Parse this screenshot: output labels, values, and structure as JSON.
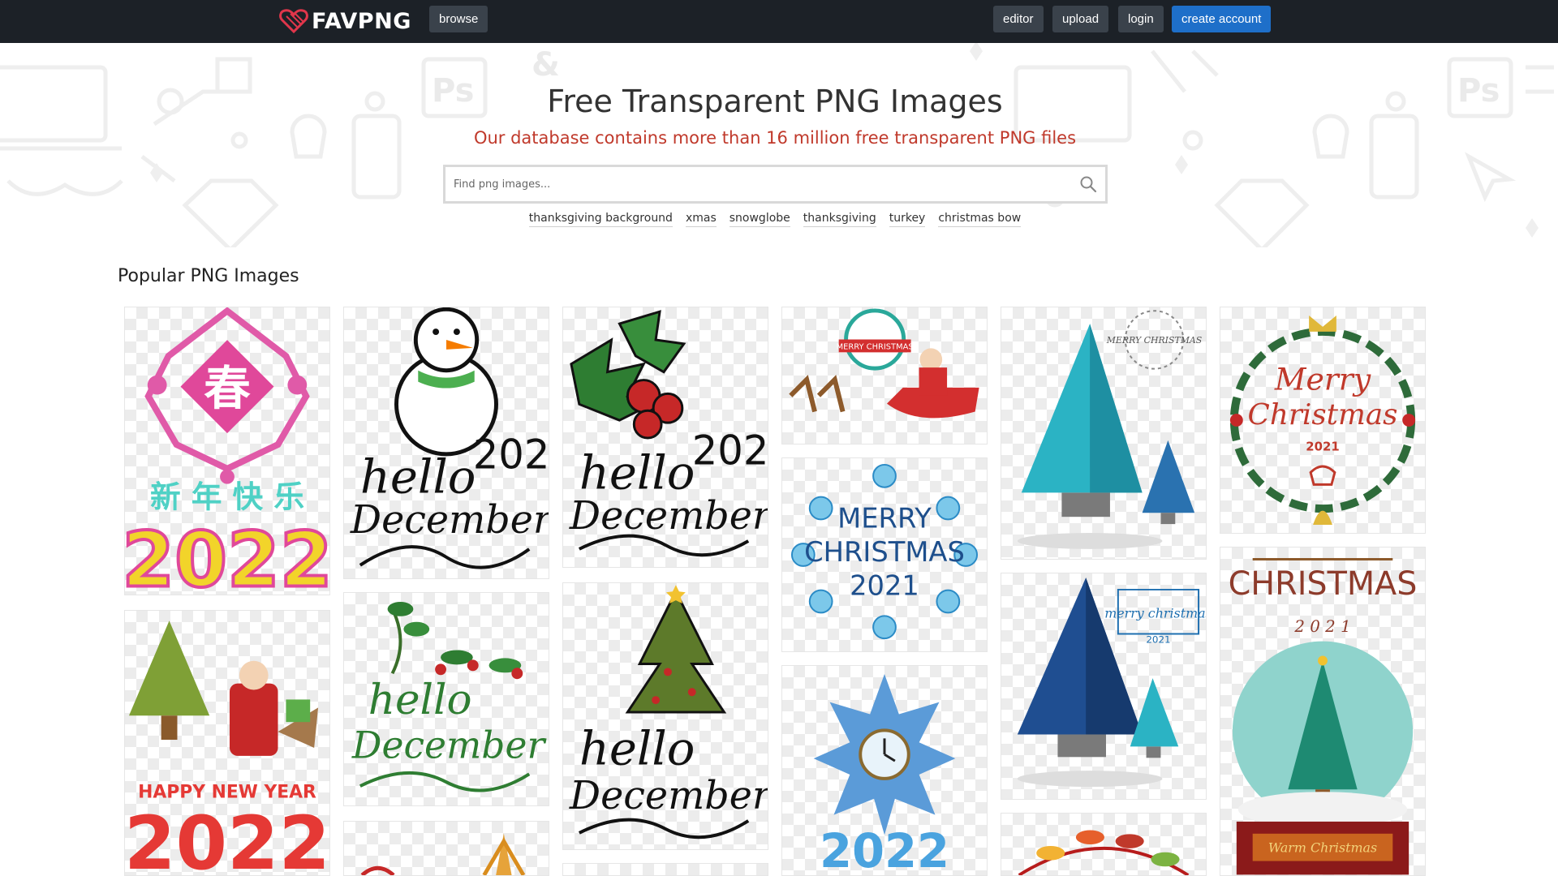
{
  "nav": {
    "brand": "FAVPNG",
    "browse": "browse",
    "editor": "editor",
    "upload": "upload",
    "login": "login",
    "create_account": "create account"
  },
  "hero": {
    "title": "Free Transparent PNG Images",
    "subtitle": "Our database contains more than 16 million free transparent PNG files",
    "search_placeholder": "Find png images...",
    "tags": [
      "thanksgiving background",
      "xmas",
      "snowglobe",
      "thanksgiving",
      "turkey",
      "christmas bow"
    ]
  },
  "section": {
    "title": "Popular PNG Images"
  },
  "images": {
    "spring_char": "春",
    "chinese_new_year": "新 年 快 乐",
    "year_2022": "2022",
    "year_2021": "2021",
    "hello": "hello",
    "december": "December",
    "merry_christmas_2021": [
      "MERRY",
      "CHRISTMAS",
      "2021"
    ],
    "merry": "Merry",
    "christmas_script": "Christmas",
    "christmas_caps": "CHRISTMAS",
    "year_spaced": "2 0 2 1",
    "merry_christmas_small": "merry christmas",
    "happy_new_year": "HAPPY NEW YEAR",
    "warm_christmas": "Warm Christmas",
    "badge_merry": "MERRY CHRISTMAS"
  },
  "colors": {
    "navbar": "#1c2127",
    "accent": "#1e6fc9",
    "subtitle": "#c0392b"
  }
}
